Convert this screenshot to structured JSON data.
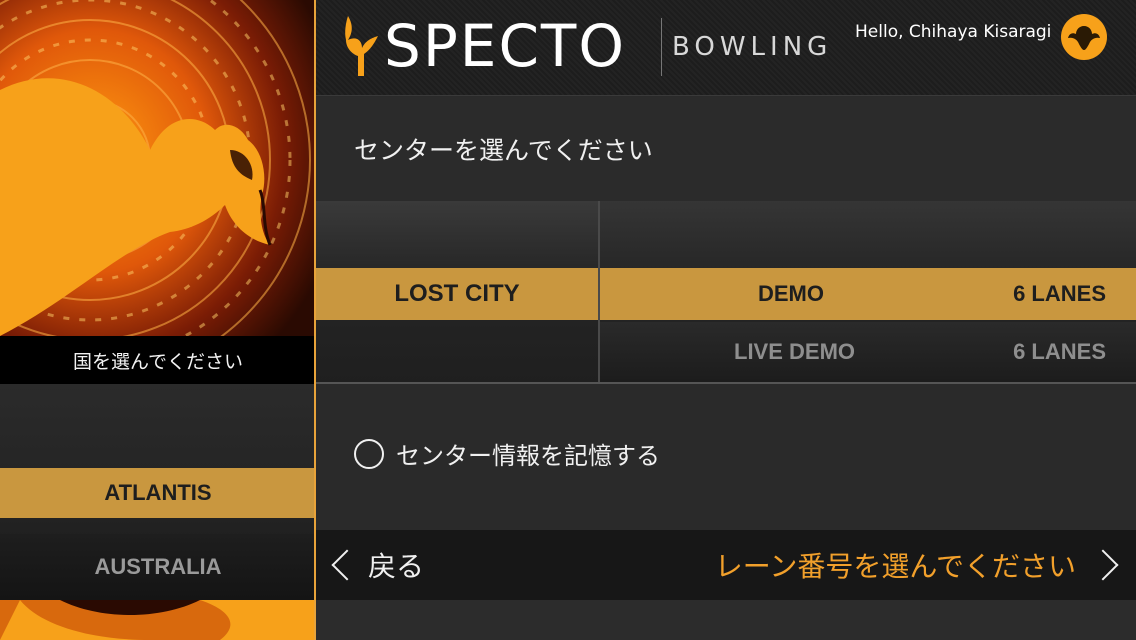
{
  "colors": {
    "accent": "#c9973f",
    "orange": "#f7a11a",
    "next_text": "#f2a02b"
  },
  "header": {
    "brand": "SPECTO",
    "brand_sub": "BOWLING",
    "greeting": "Hello, Chihaya Kisaragi",
    "avatar_icon": "phoenix-icon",
    "logo_icon": "phoenix-logo-icon"
  },
  "left": {
    "title": "国を選んでください",
    "countries": [
      {
        "label": "ATLANTIS",
        "selected": true
      },
      {
        "label": "AUSTRALIA",
        "selected": false
      }
    ]
  },
  "center": {
    "title": "センターを選んでください",
    "areas": [
      {
        "label": "LOST CITY",
        "selected": true
      }
    ],
    "centers": [
      {
        "name": "DEMO",
        "lanes": "6 LANES",
        "selected": true
      },
      {
        "name": "LIVE DEMO",
        "lanes": "6 LANES",
        "selected": false
      }
    ],
    "remember_label": "センター情報を記憶する",
    "remember_checked": false
  },
  "footer": {
    "back_label": "戻る",
    "next_label": "レーン番号を選んでください"
  }
}
